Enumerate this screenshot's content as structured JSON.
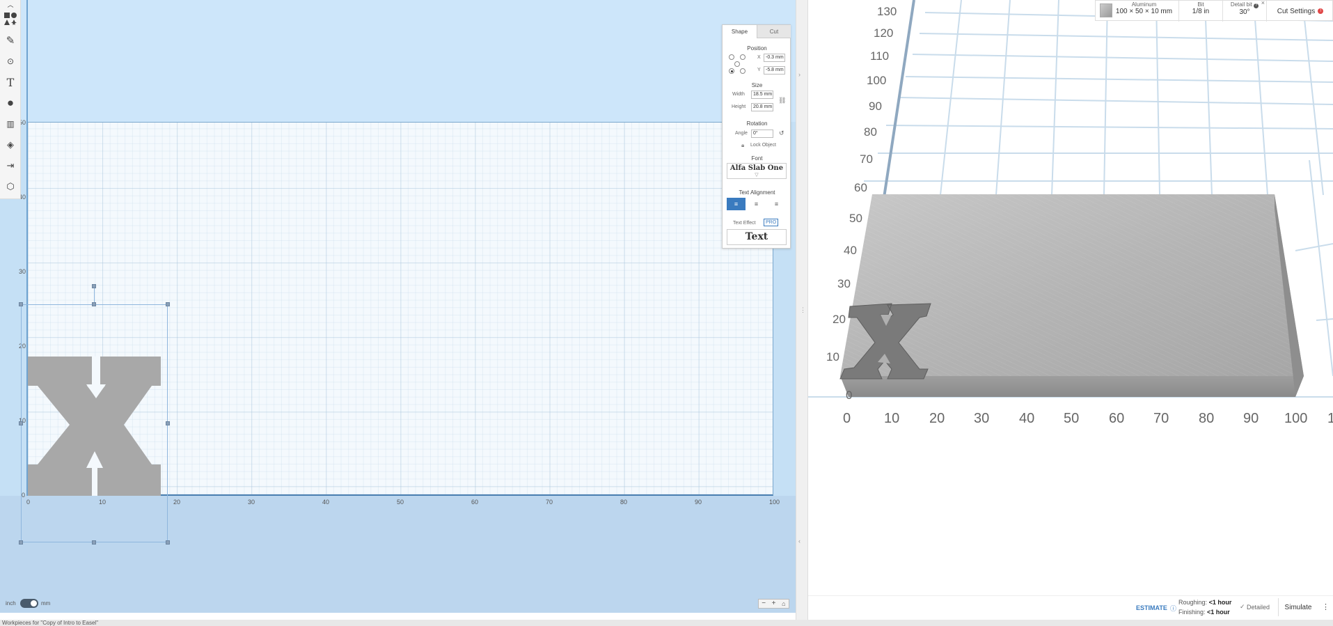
{
  "panel": {
    "tabs": [
      "Shape",
      "Cut"
    ],
    "position_label": "Position",
    "x_label": "X",
    "x_value": "-0.3 mm",
    "y_label": "Y",
    "y_value": "-5.8 mm",
    "size_label": "Size",
    "width_label": "Width",
    "width_value": "18.5 mm",
    "height_label": "Height",
    "height_value": "20.8 mm",
    "rotation_label": "Rotation",
    "angle_label": "Angle",
    "angle_value": "0°",
    "lock_label": "Lock Object",
    "font_label": "Font",
    "font_value": "Alfa Slab One",
    "align_label": "Text Alignment",
    "effect_label": "Text Effect",
    "pro_badge": "PRO",
    "effect_preview": "Text"
  },
  "design_axis": {
    "x_ticks": [
      "0",
      "10",
      "20",
      "30",
      "40",
      "50",
      "60",
      "70",
      "80",
      "90",
      "100"
    ],
    "y_ticks": [
      "0",
      "10",
      "20",
      "30",
      "40",
      "50"
    ]
  },
  "units": {
    "left": "inch",
    "right": "mm"
  },
  "topbar": {
    "material_title": "Aluminum",
    "material_dims": "100 × 50 × 10 mm",
    "bit_title": "Bit",
    "bit_value": "1/8 in",
    "detail_title": "Detail bit",
    "detail_value": "30°",
    "cut_settings": "Cut Settings"
  },
  "preview_axis": {
    "x_ticks": [
      "0",
      "10",
      "20",
      "30",
      "40",
      "50",
      "60",
      "70",
      "80",
      "90",
      "100",
      "1"
    ],
    "y_ticks": [
      "0",
      "10",
      "20",
      "30",
      "40",
      "50",
      "60",
      "70",
      "80",
      "90",
      "100",
      "110",
      "120",
      "130"
    ]
  },
  "estimate": {
    "label": "ESTIMATE",
    "roughing_label": "Roughing:",
    "roughing_value": "<1 hour",
    "finishing_label": "Finishing:",
    "finishing_value": "<1 hour",
    "detailed_label": "Detailed",
    "simulate_label": "Simulate"
  },
  "status": {
    "text": "Workpieces for \"Copy of Intro to Easel\""
  },
  "colors": {
    "accent": "#3a7bbf",
    "canvas_bg": "#c5e0f5",
    "shape_fill": "#a8a8a8"
  }
}
